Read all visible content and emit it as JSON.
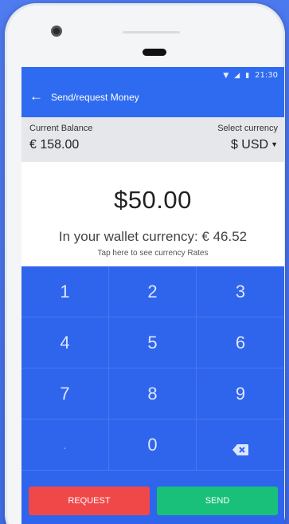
{
  "status_bar": {
    "time": "21:30",
    "icons": [
      "wifi-icon",
      "signal-icon",
      "battery-icon"
    ]
  },
  "appbar": {
    "back_icon": "arrow-left-icon",
    "title": "Send/request Money"
  },
  "balance": {
    "label": "Current Balance",
    "value": "€ 158.00"
  },
  "currency": {
    "label": "Select currency",
    "value": "$ USD"
  },
  "amount": {
    "value": "$50.00",
    "converted": "In your wallet currency: € 46.52",
    "rates_link": "Tap here to see currency Rates"
  },
  "keypad": {
    "keys": [
      "1",
      "2",
      "3",
      "4",
      "5",
      "6",
      "7",
      "8",
      "9",
      ".",
      "0"
    ],
    "backspace_icon": "backspace-icon"
  },
  "actions": {
    "request_label": "REQUEST",
    "send_label": "SEND"
  },
  "colors": {
    "primary": "#2f6bf0",
    "request": "#f04848",
    "send": "#19c07a"
  }
}
